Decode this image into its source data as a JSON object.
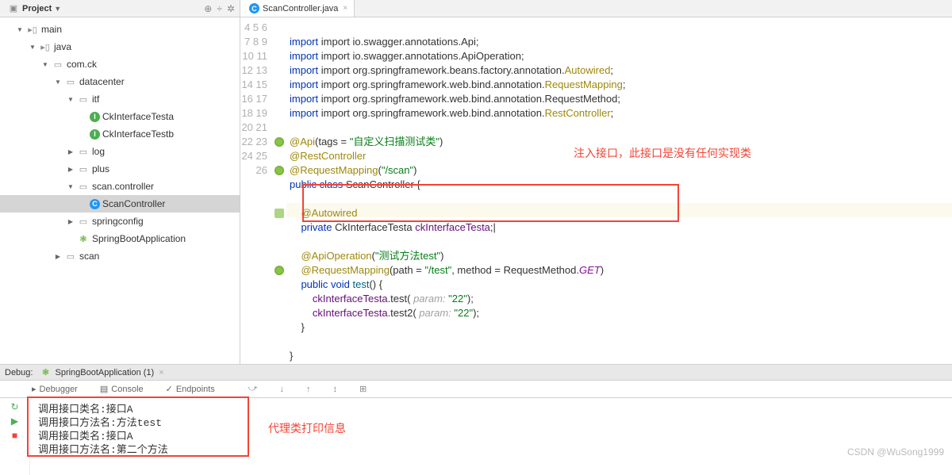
{
  "project_panel": {
    "title": "Project",
    "tree": [
      {
        "indent": 1,
        "chev": "▼",
        "icon": "folder",
        "label": "main"
      },
      {
        "indent": 2,
        "chev": "▼",
        "icon": "folder",
        "label": "java"
      },
      {
        "indent": 3,
        "chev": "▼",
        "icon": "package",
        "label": "com.ck"
      },
      {
        "indent": 4,
        "chev": "▼",
        "icon": "package",
        "label": "datacenter"
      },
      {
        "indent": 5,
        "chev": "▼",
        "icon": "package",
        "label": "itf"
      },
      {
        "indent": 6,
        "chev": "",
        "icon": "interface",
        "label": "CkInterfaceTesta"
      },
      {
        "indent": 6,
        "chev": "",
        "icon": "interface",
        "label": "CkInterfaceTestb"
      },
      {
        "indent": 5,
        "chev": "▶",
        "icon": "package",
        "label": "log"
      },
      {
        "indent": 5,
        "chev": "▶",
        "icon": "package",
        "label": "plus"
      },
      {
        "indent": 5,
        "chev": "▼",
        "icon": "package",
        "label": "scan.controller"
      },
      {
        "indent": 6,
        "chev": "",
        "icon": "class",
        "label": "ScanController",
        "selected": true
      },
      {
        "indent": 5,
        "chev": "▶",
        "icon": "package",
        "label": "springconfig"
      },
      {
        "indent": 5,
        "chev": "",
        "icon": "spring",
        "label": "SpringBootApplication"
      },
      {
        "indent": 4,
        "chev": "▶",
        "icon": "package",
        "label": "scan"
      }
    ]
  },
  "editor": {
    "tab_label": "ScanController.java",
    "line_numbers": [
      4,
      5,
      6,
      7,
      8,
      9,
      10,
      11,
      12,
      13,
      14,
      15,
      16,
      17,
      18,
      19,
      20,
      21,
      22,
      23,
      24,
      25,
      26
    ],
    "annotation_1": "注入接口，此接口是没有任何实现类",
    "code_tokens": {
      "l4": "import io.swagger.annotations.Api;",
      "l5": "import io.swagger.annotations.ApiOperation;",
      "l6_a": "import org.springframework.beans.factory.annotation.",
      "l6_b": "Autowired",
      "l6_c": ";",
      "l7_a": "import org.springframework.web.bind.annotation.",
      "l7_b": "RequestMapping",
      "l7_c": ";",
      "l8": "import org.springframework.web.bind.annotation.RequestMethod;",
      "l9_a": "import org.springframework.web.bind.annotation.",
      "l9_b": "RestController",
      "l9_c": ";",
      "l11_a": "@Api",
      "l11_b": "(tags = ",
      "l11_c": "\"自定义扫描测试类\"",
      "l11_d": ")",
      "l12": "@RestController",
      "l13_a": "@RequestMapping",
      "l13_b": "(",
      "l13_c": "\"/scan\"",
      "l13_d": ")",
      "l14_a": "public class ",
      "l14_b": "ScanController {",
      "l16": "@Autowired",
      "l17_a": "private ",
      "l17_b": "CkInterfaceTesta ",
      "l17_c": "ckInterfaceTesta",
      "l17_d": ";",
      "l19_a": "@ApiOperation",
      "l19_b": "(",
      "l19_c": "\"测试方法test\"",
      "l19_d": ")",
      "l20_a": "@RequestMapping",
      "l20_b": "(path = ",
      "l20_c": "\"/test\"",
      "l20_d": ", method = RequestMethod.",
      "l20_e": "GET",
      "l20_f": ")",
      "l21_a": "public void ",
      "l21_b": "test",
      "l21_c": "() {",
      "l22_a": "ckInterfaceTesta",
      "l22_b": ".test(",
      "l22_c": " param: ",
      "l22_d": "\"22\"",
      "l22_e": ");",
      "l23_a": "ckInterfaceTesta",
      "l23_b": ".test2(",
      "l23_c": " param: ",
      "l23_d": "\"22\"",
      "l23_e": ");",
      "l24": "}",
      "l26": "}"
    }
  },
  "debug": {
    "title": "Debug:",
    "run_config": "SpringBootApplication (1)",
    "tabs": {
      "debugger": "Debugger",
      "console": "Console",
      "endpoints": "Endpoints"
    },
    "console_lines": [
      "调用接口类名:接口A",
      "调用接口方法名:方法test",
      "调用接口类名:接口A",
      "调用接口方法名:第二个方法"
    ],
    "annotation_2": "代理类打印信息"
  },
  "watermark": "CSDN @WuSong1999"
}
